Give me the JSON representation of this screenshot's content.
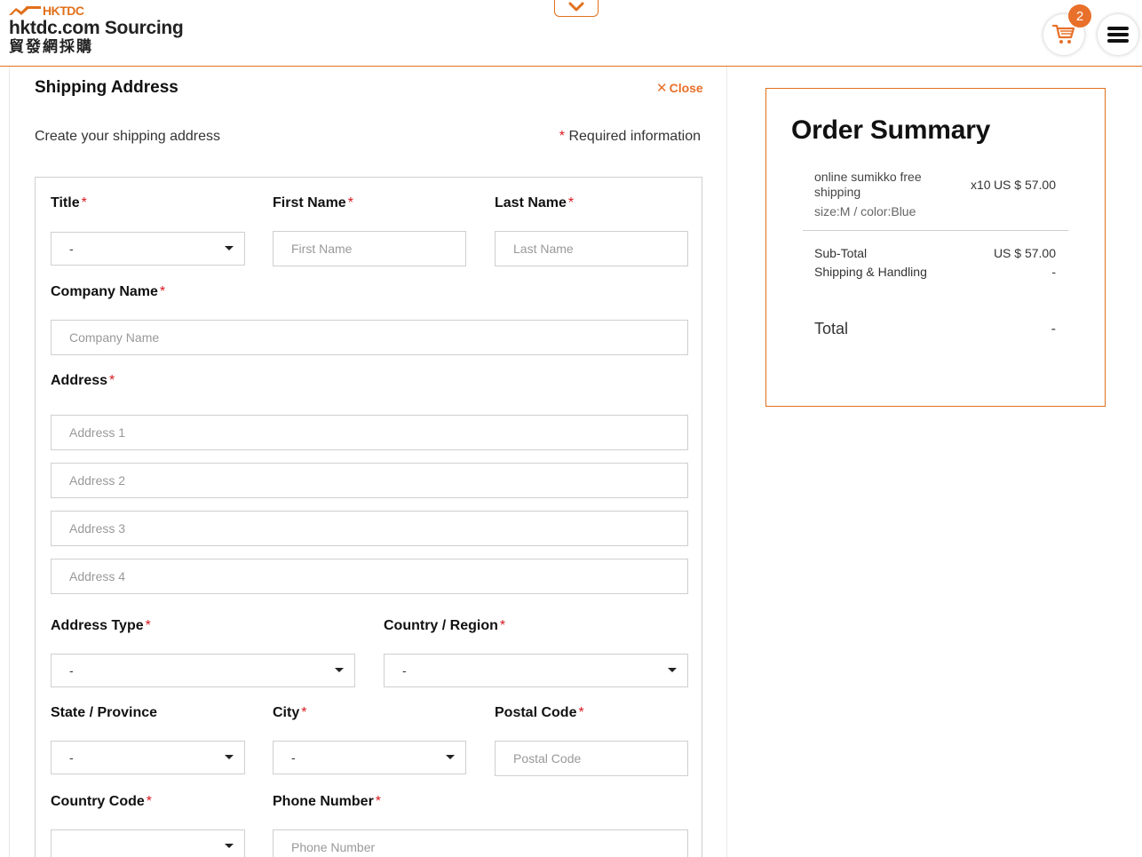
{
  "header": {
    "brand_small": "HKTDC",
    "brand_main": "hktdc.com Sourcing",
    "brand_cn": "貿發網採購",
    "cart_count": "2"
  },
  "form": {
    "title": "Shipping Address",
    "close_label": "Close",
    "subtitle": "Create your shipping address",
    "required_star": "*",
    "required_note": "Required information",
    "fields": {
      "title": {
        "label": "Title",
        "value": "-"
      },
      "first_name": {
        "label": "First Name",
        "placeholder": "First Name"
      },
      "last_name": {
        "label": "Last Name",
        "placeholder": "Last Name"
      },
      "company_name": {
        "label": "Company Name",
        "placeholder": "Company Name"
      },
      "address": {
        "label": "Address",
        "line1_placeholder": "Address 1",
        "line2_placeholder": "Address 2",
        "line3_placeholder": "Address 3",
        "line4_placeholder": "Address 4"
      },
      "address_type": {
        "label": "Address Type",
        "value": "-"
      },
      "country_region": {
        "label": "Country / Region",
        "value": "-"
      },
      "state_province": {
        "label": "State / Province",
        "value": "-"
      },
      "city": {
        "label": "City",
        "value": "-"
      },
      "postal_code": {
        "label": "Postal Code",
        "placeholder": "Postal Code"
      },
      "country_code": {
        "label": "Country Code",
        "value": ""
      },
      "phone_number": {
        "label": "Phone Number",
        "placeholder": "Phone Number"
      }
    }
  },
  "summary": {
    "title": "Order Summary",
    "item": {
      "name": "online sumikko free shipping",
      "variant": "size:M / color:Blue",
      "qty": "x10",
      "price": "US $ 57.00"
    },
    "subtotal_label": "Sub-Total",
    "subtotal_value": "US $ 57.00",
    "shipping_label": "Shipping & Handling",
    "shipping_value": "-",
    "total_label": "Total",
    "total_value": "-"
  },
  "colors": {
    "accent": "#e8702a",
    "required": "#d71920",
    "border": "#cfcfcf"
  }
}
